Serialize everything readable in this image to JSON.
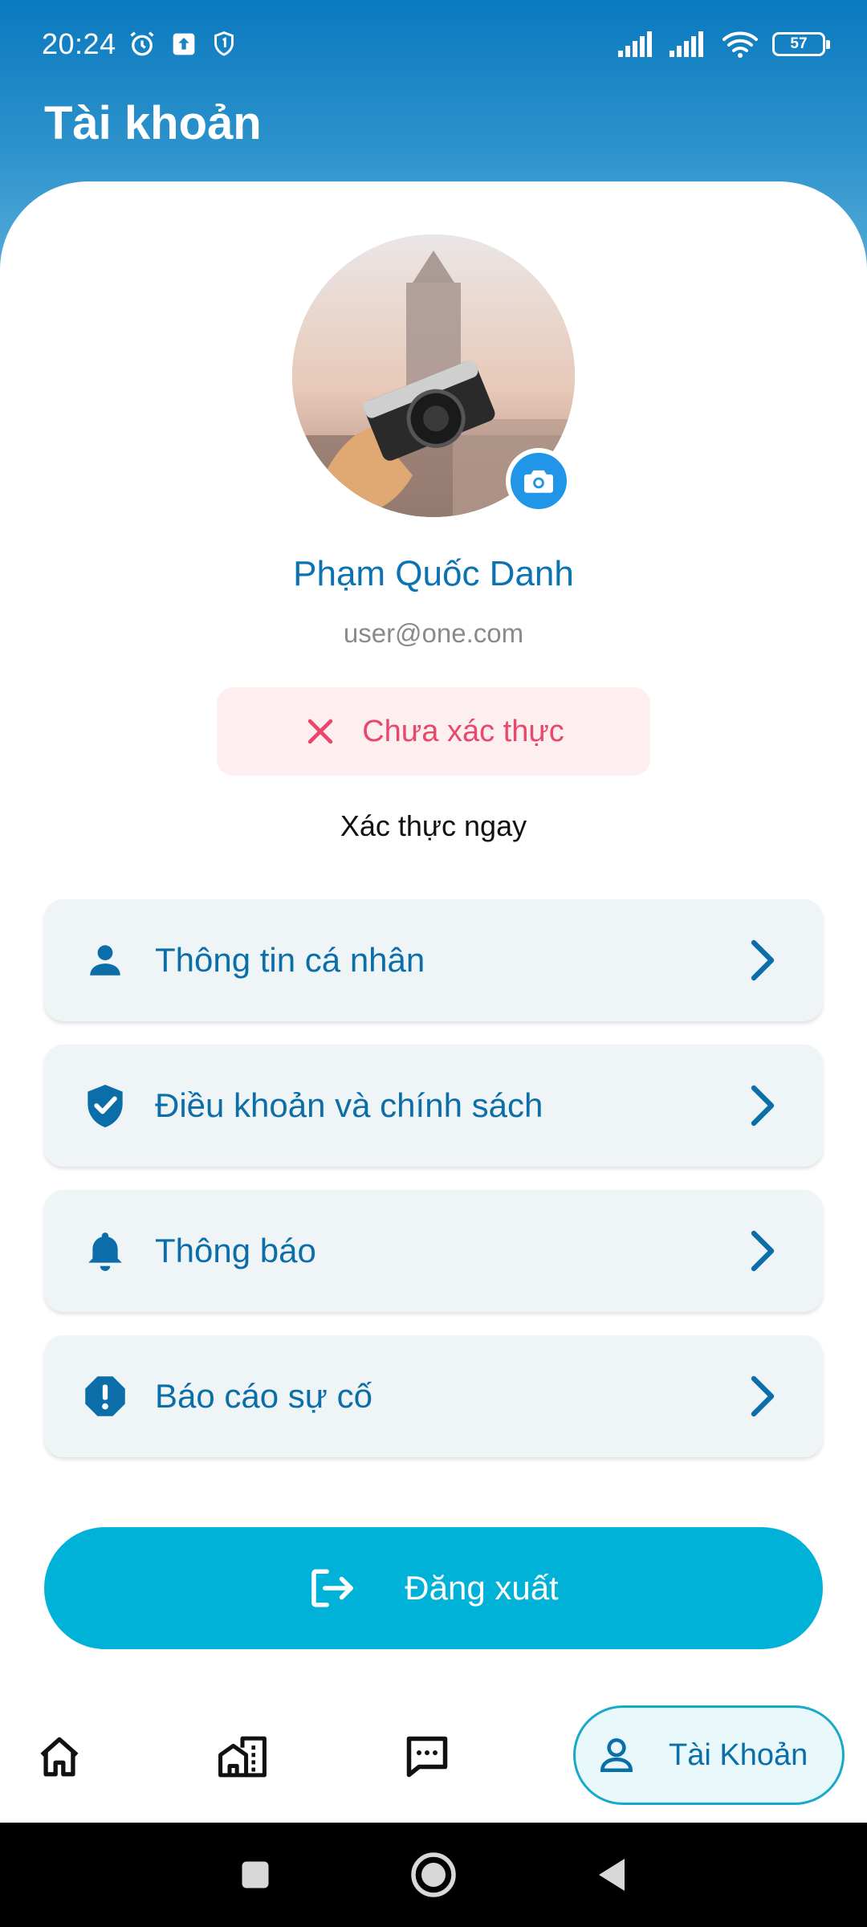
{
  "status_bar": {
    "time": "20:24",
    "battery": "57"
  },
  "header": {
    "title": "Tài khoản"
  },
  "profile": {
    "name": "Phạm Quốc Danh",
    "email": "user@one.com",
    "verify_status": "Chưa xác thực",
    "verify_action": "Xác thực ngay"
  },
  "menu": {
    "items": [
      {
        "label": "Thông tin cá nhân",
        "icon": "person-icon"
      },
      {
        "label": "Điều khoản và chính sách",
        "icon": "shield-check-icon"
      },
      {
        "label": "Thông báo",
        "icon": "bell-icon"
      },
      {
        "label": "Báo cáo sự cố",
        "icon": "alert-octagon-icon"
      }
    ]
  },
  "logout": {
    "label": "Đăng xuất"
  },
  "bottom_nav": {
    "items": [
      {
        "icon": "home-icon"
      },
      {
        "icon": "buildings-icon"
      },
      {
        "icon": "chat-icon"
      },
      {
        "icon": "account-icon",
        "label": "Tài Khoản"
      }
    ]
  },
  "colors": {
    "primary_blue": "#0b6ea8",
    "accent_cyan": "#00b1d8",
    "error_pink": "#e8486b",
    "menu_bg": "#eff5f6"
  }
}
